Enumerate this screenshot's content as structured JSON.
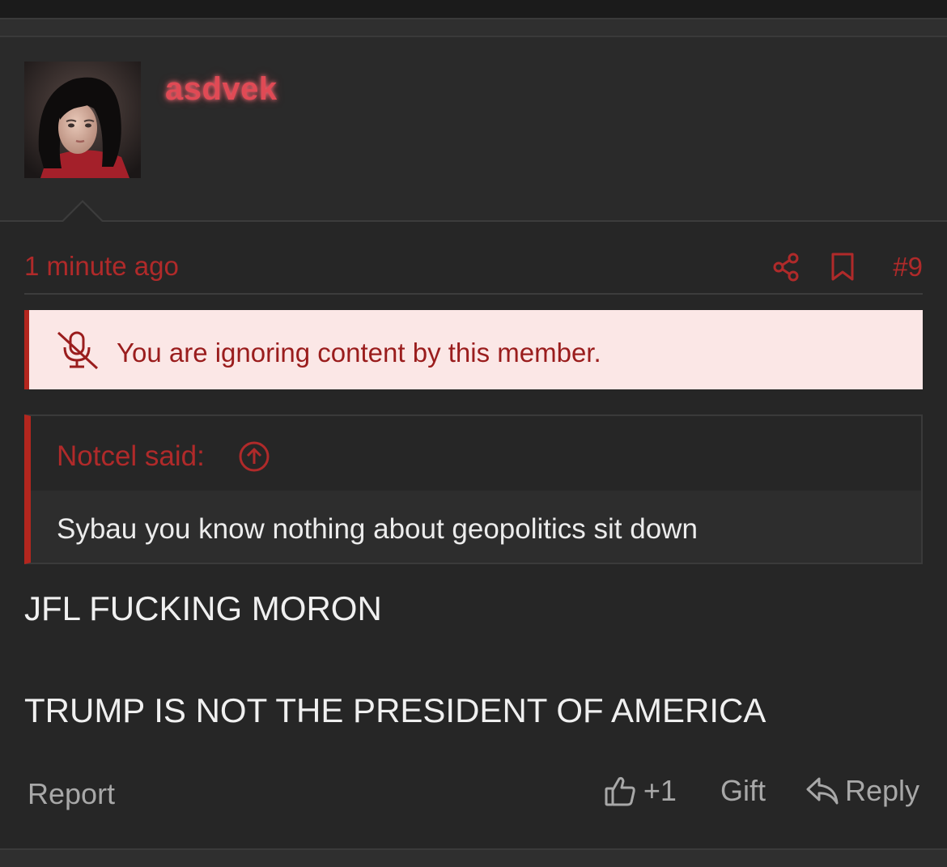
{
  "post": {
    "username": "asdvek",
    "timestamp": "1 minute ago",
    "post_number": "#9",
    "ignore_notice": "You are ignoring content by this member.",
    "quote": {
      "author": "Notcel said:",
      "text": "Sybau you know nothing about geopolitics sit down"
    },
    "body_lines": [
      "JFL FUCKING MORON",
      "TRUMP IS NOT THE PRESIDENT OF AMERICA"
    ]
  },
  "footer": {
    "report_label": "Report",
    "like_label": "+1",
    "gift_label": "Gift",
    "reply_label": "Reply"
  },
  "icons": {
    "share": "share-icon",
    "bookmark": "bookmark-icon",
    "ignore": "microphone-slash-icon",
    "quote_jump": "arrow-up-circle-icon",
    "like": "thumbs-up-icon",
    "reply": "reply-arrow-icon"
  },
  "colors": {
    "background": "#262626",
    "accent_red": "#b02a2a",
    "username": "#e04a55",
    "notice_bg": "#fbe7e6",
    "notice_text": "#9a1d1d",
    "muted_text": "#a8a8a8"
  }
}
